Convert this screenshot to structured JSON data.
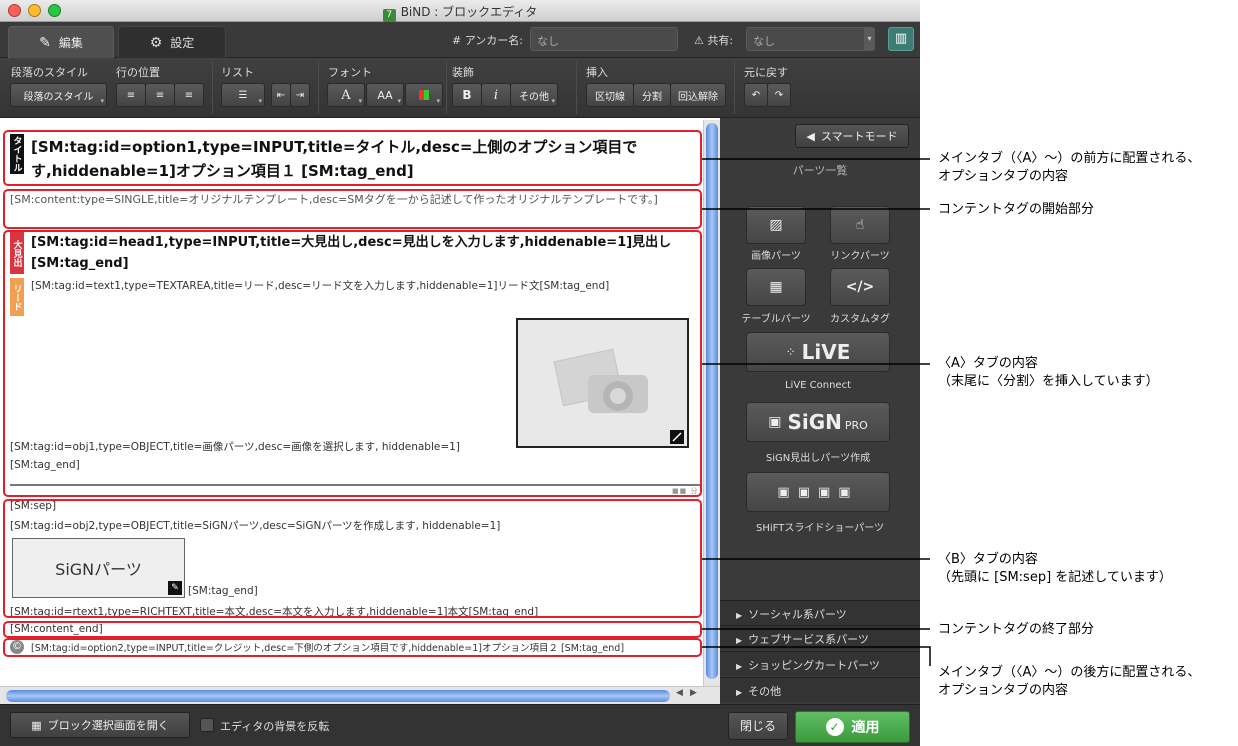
{
  "window": {
    "title": "BiND : ブロックエディタ",
    "app_icon": "7"
  },
  "tabs": {
    "edit": "編集",
    "settings": "設定"
  },
  "toolbar_top": {
    "anchor_label": "# アンカー名:",
    "anchor_value": "なし",
    "share_label": "共有:",
    "share_value": "なし"
  },
  "toolbar": {
    "paragraph_style_label": "段落のスタイル",
    "paragraph_style_button": "段落のスタイル",
    "line_position_label": "行の位置",
    "list_label": "リスト",
    "font_label": "フォント",
    "font_a": "A",
    "font_aa": "AA",
    "decoration_label": "装飾",
    "bold": "B",
    "italic": "i",
    "other": "その他",
    "insert_label": "挿入",
    "divider": "区切線",
    "split": "分割",
    "unwrap": "回込解除",
    "undo_label": "元に戻す"
  },
  "editor": {
    "title_tag_label": "タイトル",
    "title_text": "[SM:tag:id=option1,type=INPUT,title=タイトル,desc=上側のオプション項目です,hiddenable=1]オプション項目１ [SM:tag_end]",
    "content_start": "[SM:content:type=SINGLE,title=オリジナルテンプレート,desc=SMタグを一から記述して作ったオリジナルテンプレートです。]",
    "heading_tag_label": "大見出",
    "heading_text": "[SM:tag:id=head1,type=INPUT,title=大見出し,desc=見出しを入力します,hiddenable=1]見出し[SM:tag_end]",
    "lead_tag_label": "リード",
    "lead_text": "[SM:tag:id=text1,type=TEXTAREA,title=リード,desc=リード文を入力します,hiddenable=1]リード文[SM:tag_end]",
    "obj1_text": "[SM:tag:id=obj1,type=OBJECT,title=画像パーツ,desc=画像を選択します, hiddenable=1]",
    "obj1_end": "[SM:tag_end]",
    "sep": "[SM:sep]",
    "obj2_text": "[SM:tag:id=obj2,type=OBJECT,title=SiGNパーツ,desc=SiGNパーツを作成します, hiddenable=1]",
    "sign_parts_label": "SiGNパーツ",
    "obj2_end": "[SM:tag_end]",
    "rtext": "[SM:tag:id=rtext1,type=RICHTEXT,title=本文,desc=本文を入力します,hiddenable=1]本文[SM:tag_end]",
    "content_end": "[SM:content_end]",
    "credit_text": "[SM:tag:id=option2,type=INPUT,title=クレジット,desc=下側のオプション項目です,hiddenable=1]オプション項目２ [SM:tag_end]",
    "credit_icon": "©"
  },
  "sidebar": {
    "smart_mode": "スマートモード",
    "parts_title": "パーツ一覧",
    "image_parts": "画像パーツ",
    "link_parts": "リンクパーツ",
    "table_parts": "テーブルパーツ",
    "custom_tag": "カスタムタグ",
    "custom_tag_glyph": "</>",
    "live_logo": "LiVE",
    "live_connect": "LiVE Connect",
    "sign_logo": "SiGN",
    "sign_pro": "PRO",
    "sign_caption": "SiGN見出しパーツ作成",
    "shift_caption": "SHiFTスライドショーパーツ",
    "accordion": [
      "ソーシャル系パーツ",
      "ウェブサービス系パーツ",
      "ショッピングカートパーツ",
      "その他"
    ]
  },
  "bottom": {
    "open_block": "ブロック選択画面を開く",
    "bg_invert": "エディタの背景を反転",
    "close": "閉じる",
    "apply": "適用"
  },
  "annotations": {
    "a1_l1": "メインタブ（〈A〉〜）の前方に配置される、",
    "a1_l2": "オプションタブの内容",
    "a2": "コンテントタグの開始部分",
    "a3_l1": "〈A〉タブの内容",
    "a3_l2": "（末尾に〈分割〉を挿入しています）",
    "a4_l1": "〈B〉タブの内容",
    "a4_l2": "（先頭に [SM:sep] を記述しています）",
    "a5": "コンテントタグの終了部分",
    "a6_l1": "メインタブ（〈A〉〜）の後方に配置される、",
    "a6_l2": "オプションタブの内容"
  },
  "colors": {
    "annotation_red": "#e0202a",
    "apply_green": "#4caf50",
    "title_tag": "#111111",
    "heading_tag": "#d9343f",
    "lead_tag": "#f0a050"
  }
}
